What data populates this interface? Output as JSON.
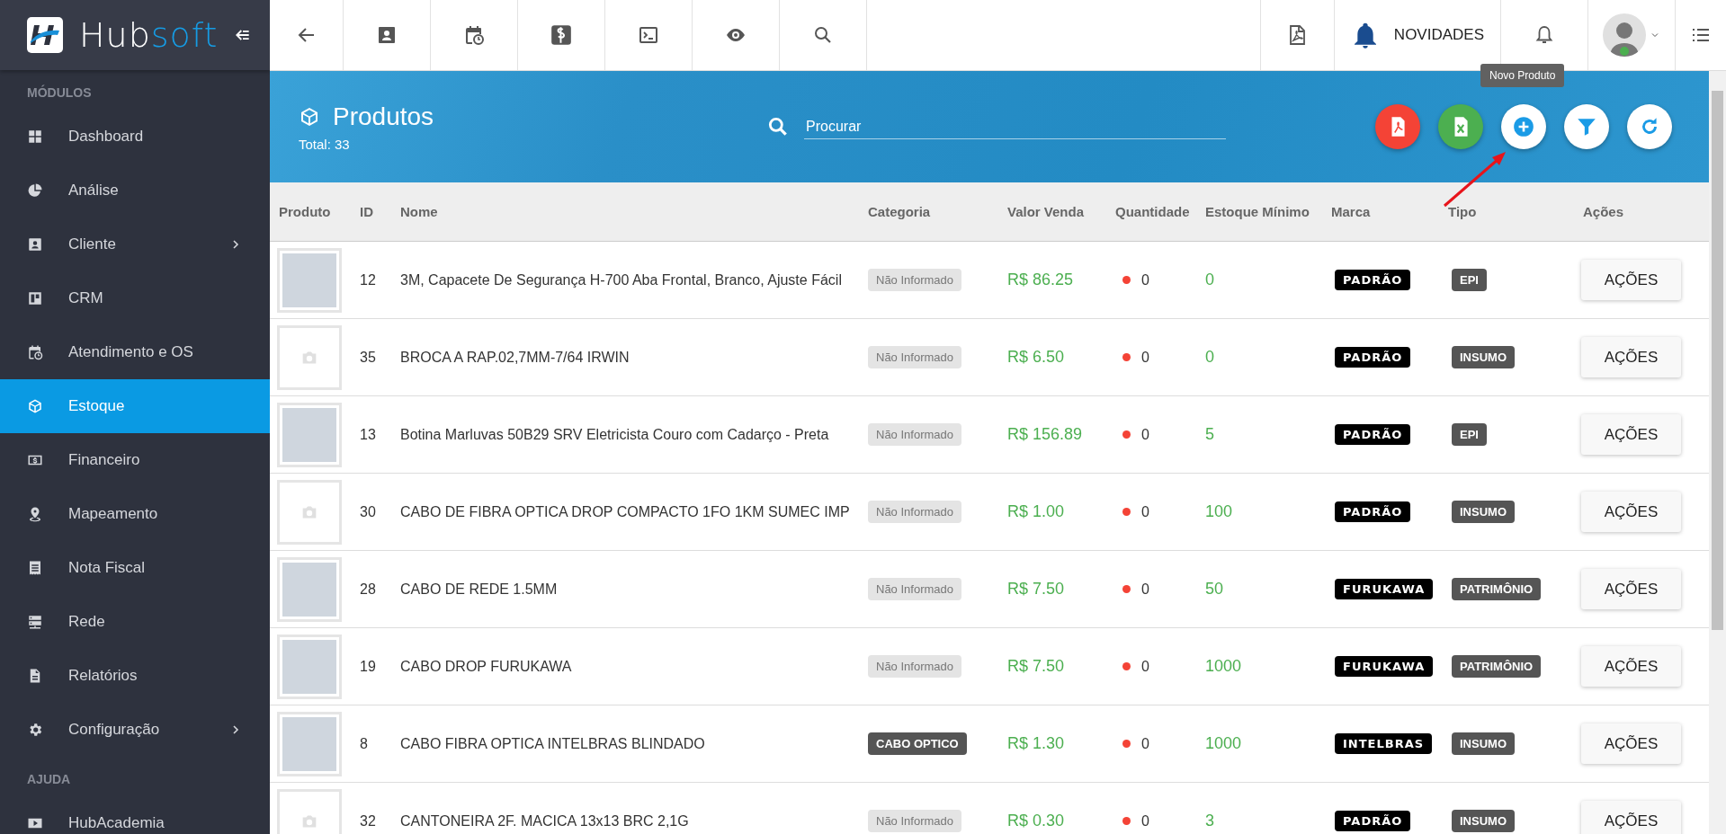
{
  "sidebar": {
    "brand_first": "Hub",
    "brand_second": "soft",
    "sections": [
      {
        "label": "MÓDULOS",
        "items": [
          {
            "label": "Dashboard",
            "has_submenu": false,
            "selected": false
          },
          {
            "label": "Análise",
            "has_submenu": false,
            "selected": false
          },
          {
            "label": "Cliente",
            "has_submenu": true,
            "selected": false
          },
          {
            "label": "CRM",
            "has_submenu": false,
            "selected": false
          },
          {
            "label": "Atendimento e OS",
            "has_submenu": false,
            "selected": false
          },
          {
            "label": "Estoque",
            "has_submenu": false,
            "selected": true
          },
          {
            "label": "Financeiro",
            "has_submenu": false,
            "selected": false
          },
          {
            "label": "Mapeamento",
            "has_submenu": false,
            "selected": false
          },
          {
            "label": "Nota Fiscal",
            "has_submenu": false,
            "selected": false
          },
          {
            "label": "Rede",
            "has_submenu": false,
            "selected": false
          },
          {
            "label": "Relatórios",
            "has_submenu": false,
            "selected": false
          },
          {
            "label": "Configuração",
            "has_submenu": true,
            "selected": false
          }
        ]
      },
      {
        "label": "AJUDA",
        "items": [
          {
            "label": "HubAcademia",
            "has_submenu": false,
            "selected": false
          }
        ]
      }
    ]
  },
  "topbar": {
    "news_label": "NOVIDADES"
  },
  "tooltip": "Novo Produto",
  "page_header": {
    "title": "Produtos",
    "total": "Total: 33",
    "search_placeholder": "Procurar"
  },
  "table": {
    "columns": [
      "Produto",
      "ID",
      "Nome",
      "Categoria",
      "Valor Venda",
      "Quantidade",
      "Estoque Mínimo",
      "Marca",
      "Tipo",
      "Ações"
    ],
    "rows": [
      {
        "has_photo": true,
        "id": "12",
        "name": "3M, Capacete De Segurança H-700 Aba Frontal, Branco, Ajuste Fácil",
        "category": {
          "text": "Não Informado",
          "kind": "unset"
        },
        "price": "R$ 86.25",
        "quantity": {
          "text": "0",
          "color": "#f44336"
        },
        "min_stock": "0",
        "brand": "PADRÃO",
        "type": "EPI",
        "action": "AÇÕES"
      },
      {
        "has_photo": false,
        "id": "35",
        "name": "BROCA A RAP.02,7MM-7/64 IRWIN",
        "category": {
          "text": "Não Informado",
          "kind": "unset"
        },
        "price": "R$ 6.50",
        "quantity": {
          "text": "0",
          "color": "#f44336"
        },
        "min_stock": "0",
        "brand": "PADRÃO",
        "type": "INSUMO",
        "action": "AÇÕES"
      },
      {
        "has_photo": true,
        "id": "13",
        "name": "Botina Marluvas 50B29 SRV Eletricista Couro com Cadarço - Preta",
        "category": {
          "text": "Não Informado",
          "kind": "unset"
        },
        "price": "R$ 156.89",
        "quantity": {
          "text": "0",
          "color": "#f44336"
        },
        "min_stock": "5",
        "brand": "PADRÃO",
        "type": "EPI",
        "action": "AÇÕES"
      },
      {
        "has_photo": false,
        "id": "30",
        "name": "CABO DE FIBRA OPTICA DROP COMPACTO 1FO 1KM SUMEC IMP",
        "category": {
          "text": "Não Informado",
          "kind": "unset"
        },
        "price": "R$ 1.00",
        "quantity": {
          "text": "0",
          "color": "#f44336"
        },
        "min_stock": "100",
        "brand": "PADRÃO",
        "type": "INSUMO",
        "action": "AÇÕES"
      },
      {
        "has_photo": true,
        "id": "28",
        "name": "CABO DE REDE 1.5MM",
        "category": {
          "text": "Não Informado",
          "kind": "unset"
        },
        "price": "R$ 7.50",
        "quantity": {
          "text": "0",
          "color": "#f44336"
        },
        "min_stock": "50",
        "brand": "FURUKAWA",
        "type": "PATRIMÔNIO",
        "action": "AÇÕES"
      },
      {
        "has_photo": true,
        "id": "19",
        "name": "CABO DROP FURUKAWA",
        "category": {
          "text": "Não Informado",
          "kind": "unset"
        },
        "price": "R$ 7.50",
        "quantity": {
          "text": "0",
          "color": "#f44336"
        },
        "min_stock": "1000",
        "brand": "FURUKAWA",
        "type": "PATRIMÔNIO",
        "action": "AÇÕES"
      },
      {
        "has_photo": true,
        "id": "8",
        "name": "CABO FIBRA OPTICA INTELBRAS BLINDADO",
        "category": {
          "text": "CABO OPTICO",
          "kind": "set"
        },
        "price": "R$ 1.30",
        "quantity": {
          "text": "0",
          "color": "#f44336"
        },
        "min_stock": "1000",
        "brand": "INTELBRAS",
        "type": "INSUMO",
        "action": "AÇÕES"
      },
      {
        "has_photo": false,
        "id": "32",
        "name": "CANTONEIRA 2F. MACICA 13x13 BRC 2,1G",
        "category": {
          "text": "Não Informado",
          "kind": "unset"
        },
        "price": "R$ 0.30",
        "quantity": {
          "text": "0",
          "color": "#f44336"
        },
        "min_stock": "3",
        "brand": "PADRÃO",
        "type": "INSUMO",
        "action": "AÇÕES"
      }
    ]
  }
}
